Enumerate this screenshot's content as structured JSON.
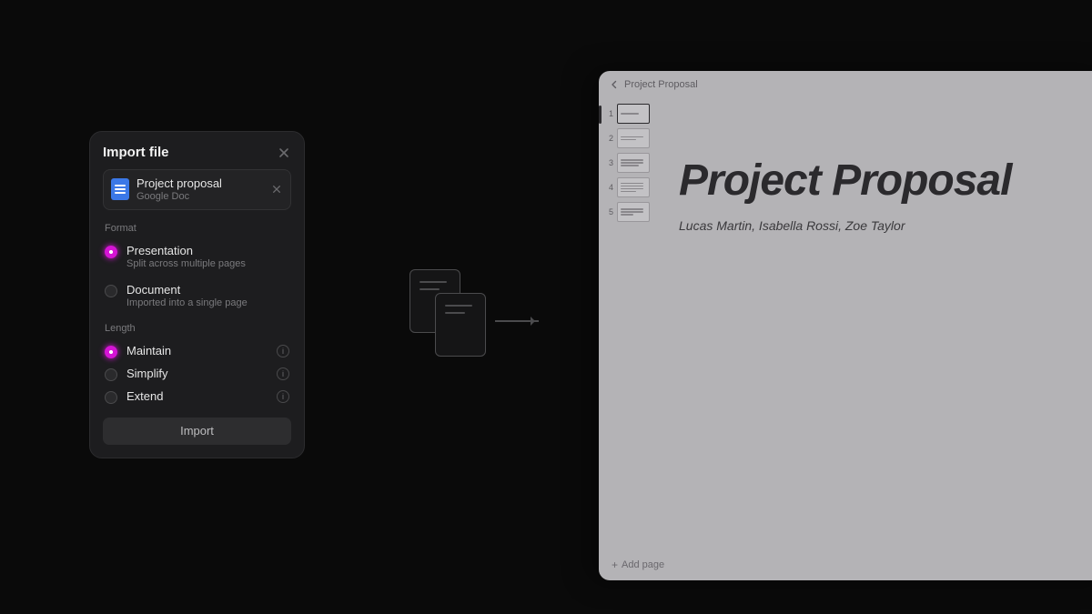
{
  "dialog": {
    "title": "Import file",
    "file": {
      "name": "Project proposal",
      "type": "Google Doc"
    },
    "format": {
      "label": "Format",
      "options": [
        {
          "title": "Presentation",
          "subtitle": "Split across multiple pages",
          "selected": true
        },
        {
          "title": "Document",
          "subtitle": "Imported into a single page",
          "selected": false
        }
      ]
    },
    "length": {
      "label": "Length",
      "options": [
        {
          "title": "Maintain",
          "selected": true
        },
        {
          "title": "Simplify",
          "selected": false
        },
        {
          "title": "Extend",
          "selected": false
        }
      ]
    },
    "import_label": "Import"
  },
  "preview": {
    "breadcrumb": "Project Proposal",
    "title": "Project Proposal",
    "authors": "Lucas Martin, Isabella Rossi, Zoe Taylor",
    "thumbs": [
      {
        "n": "1",
        "active": true,
        "lines": [
          "70%"
        ]
      },
      {
        "n": "2",
        "active": false,
        "lines": [
          "90%",
          "60%"
        ]
      },
      {
        "n": "3",
        "active": false,
        "lines": [
          "90%",
          "90%",
          "70%"
        ]
      },
      {
        "n": "4",
        "active": false,
        "lines": [
          "90%",
          "90%",
          "90%",
          "60%"
        ]
      },
      {
        "n": "5",
        "active": false,
        "lines": [
          "90%",
          "90%",
          "50%"
        ]
      }
    ],
    "add_page": "Add page"
  },
  "colors": {
    "accent": "#d514d5"
  }
}
